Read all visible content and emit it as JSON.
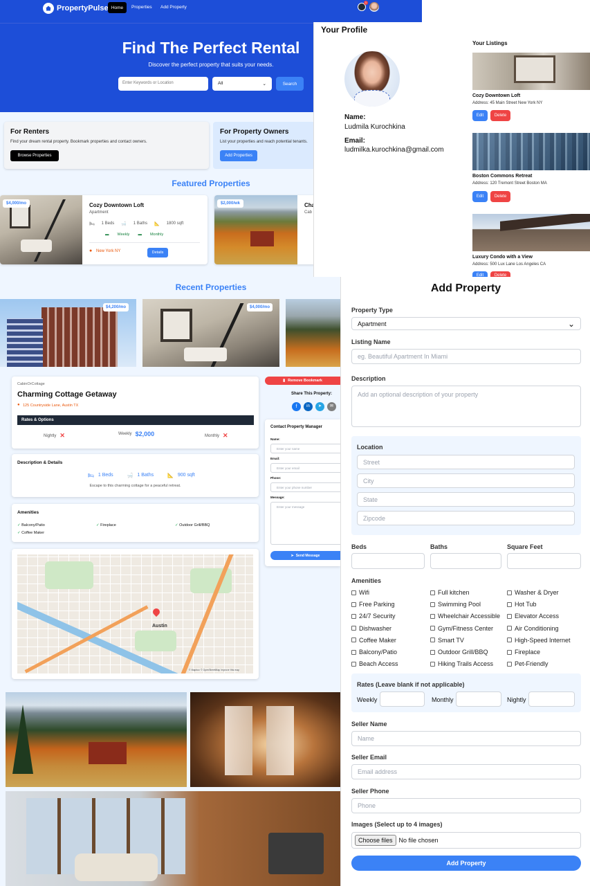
{
  "nav": {
    "brand": "PropertyPulse",
    "links": [
      "Home",
      "Properties",
      "Add Property"
    ],
    "notif": "1"
  },
  "hero": {
    "title": "Find The Perfect Rental",
    "subtitle": "Discover the perfect property that suits your needs.",
    "search_placeholder": "Enter Keywords or Location",
    "type_value": "All",
    "search_button": "Search"
  },
  "renters": {
    "title": "For Renters",
    "text": "Find your dream rental property. Bookmark properties and contact owners.",
    "button": "Browse Properties"
  },
  "owners": {
    "title": "For Property Owners",
    "text": "List your properties and reach potential tenants.",
    "button": "Add Properties"
  },
  "featured": {
    "heading": "Featured Properties",
    "card1": {
      "price": "$4,000/mo",
      "name": "Cozy Downtown Loft",
      "type": "Apartment",
      "beds": "1 Beds",
      "baths": "1 Baths",
      "sqft": "1800 sqft",
      "weekly": "Weekly",
      "monthly": "Monthly",
      "location": "New York NY",
      "details": "Details"
    },
    "card2": {
      "price": "$2,000/wk",
      "name": "Cha",
      "sub": "Cab"
    }
  },
  "profile": {
    "title": "Your Profile",
    "name_label": "Name:",
    "name": "Ludmila Kurochkina",
    "email_label": "Email:",
    "email": "ludmilka.kurochkina@gmail.com",
    "listings_title": "Your Listings",
    "edit": "Edit",
    "delete": "Delete",
    "listings": [
      {
        "name": "Cozy Downtown Loft",
        "address": "Address: 45 Main Street New York NY"
      },
      {
        "name": "Boston Commons Retreat",
        "address": "Address: 120 Tremont Street Boston MA"
      },
      {
        "name": "Luxury Condo with a View",
        "address": "Address: 500 Lux Lane Los Angeles CA"
      }
    ]
  },
  "recent": {
    "heading": "Recent Properties",
    "price1": "$4,200/mo",
    "price2": "$4,000/mo"
  },
  "detail": {
    "type": "CabinOrCottage",
    "name": "Charming Cottage Getaway",
    "address": "125 Countryside Lane, Austin TX",
    "rates_title": "Rates & Options",
    "nightly": "Nightly",
    "weekly": "Weekly",
    "weekly_val": "$2,000",
    "monthly": "Monthly",
    "desc_title": "Description & Details",
    "beds": "1 Beds",
    "baths": "1 Baths",
    "sqft": "900 sqft",
    "desc": "Escape to this charming cottage for a peaceful retreat.",
    "amen_title": "Amenities",
    "amenities": [
      "Balcony/Patio",
      "Fireplace",
      "Outdoor Grill/BBQ",
      "Coffee Maker"
    ],
    "map_city": "Austin",
    "map_credit": "© Mapbox © OpenStreetMap Improve this map"
  },
  "side": {
    "remove": "Remove Bookmark",
    "share": "Share This Property:",
    "contact_title": "Contact Property Manager",
    "name": "Name:",
    "name_ph": "Enter your name",
    "email": "Email:",
    "email_ph": "Enter your email",
    "phone": "Phone:",
    "phone_ph": "Enter your phone number",
    "message": "Message:",
    "message_ph": "Enter your message",
    "send": "Send Message"
  },
  "add": {
    "title": "Add Property",
    "type_label": "Property Type",
    "type_value": "Apartment",
    "listing_label": "Listing Name",
    "listing_ph": "eg. Beautiful Apartment In Miami",
    "desc_label": "Description",
    "desc_ph": "Add an optional description of your property",
    "loc_label": "Location",
    "street": "Street",
    "city": "City",
    "state": "State",
    "zip": "Zipcode",
    "beds": "Beds",
    "baths": "Baths",
    "sqft": "Square Feet",
    "amen_label": "Amenities",
    "amenities": [
      "Wifi",
      "Full kitchen",
      "Washer & Dryer",
      "Free Parking",
      "Swimming Pool",
      "Hot Tub",
      "24/7 Security",
      "Wheelchair Accessible",
      "Elevator Access",
      "Dishwasher",
      "Gym/Fitness Center",
      "Air Conditioning",
      "Coffee Maker",
      "Smart TV",
      "High-Speed Internet",
      "Balcony/Patio",
      "Outdoor Grill/BBQ",
      "Fireplace",
      "Beach Access",
      "Hiking Trails Access",
      "Pet-Friendly"
    ],
    "rates_label": "Rates (Leave blank if not applicable)",
    "weekly": "Weekly",
    "monthly": "Monthly",
    "nightly": "Nightly",
    "seller_name": "Seller Name",
    "seller_name_ph": "Name",
    "seller_email": "Seller Email",
    "seller_email_ph": "Email address",
    "seller_phone": "Seller Phone",
    "seller_phone_ph": "Phone",
    "images_label": "Images (Select up to 4 images)",
    "choose": "Choose files",
    "no_file": "No file chosen",
    "submit": "Add Property"
  },
  "colors": {
    "primary": "#1d4ed8",
    "accent": "#3b82f6",
    "danger": "#ef4444"
  }
}
